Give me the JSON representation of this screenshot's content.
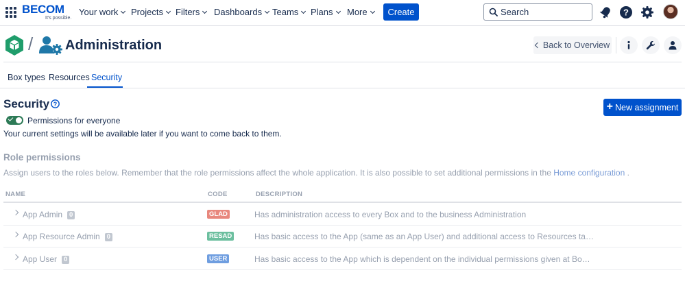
{
  "topnav": {
    "logo_brand": "BECOM",
    "logo_tagline": "It's possible.",
    "items": [
      "Your work",
      "Projects",
      "Filters",
      "Dashboards",
      "Teams",
      "Plans",
      "More"
    ],
    "create_label": "Create",
    "search_placeholder": "Search",
    "icons": [
      "app-switcher-icon",
      "notifications-icon",
      "help-icon",
      "settings-icon",
      "profile-avatar"
    ]
  },
  "header": {
    "title": "Administration",
    "back_label": "Back to Overview",
    "icons": [
      "info-icon",
      "wrench-icon",
      "user-icon"
    ]
  },
  "tabs": [
    {
      "label": "Box types",
      "active": false
    },
    {
      "label": "Resources",
      "active": false
    },
    {
      "label": "Security",
      "active": true
    }
  ],
  "security": {
    "title": "Security",
    "new_assignment_label": "New assignment",
    "toggle_label": "Permissions for everyone",
    "toggle_on": true,
    "info_text": "Your current settings will be available later if you want to come back to them."
  },
  "role_permissions": {
    "title": "Role permissions",
    "description": "Assign users to the roles below. Remember that the role permissions affect the whole application. It is also possible to set additional permissions in the",
    "link_text": "Home configuration",
    "trailing": "."
  },
  "table": {
    "columns": [
      "NAME",
      "CODE",
      "DESCRIPTION"
    ],
    "rows": [
      {
        "name": "App Admin",
        "count": "0",
        "code": "GLAD",
        "code_color": "#e8877d",
        "description": "Has administration access to every Box and to the business Administration"
      },
      {
        "name": "App Resource Admin",
        "count": "0",
        "code": "RESAD",
        "code_color": "#6cbf9f",
        "description": "Has basic access to the App (same as an App User) and additional access to Resources tab in Administration"
      },
      {
        "name": "App User",
        "count": "0",
        "code": "USER",
        "code_color": "#6f9ee0",
        "description": "Has basic access to the App which is dependent on the individual permissions given at Box levels"
      }
    ]
  },
  "colors": {
    "primary": "#0052cc",
    "toggle_on": "#2c7a56",
    "app_logo": "#1f9d6b",
    "admin_icon": "#1f78a8"
  }
}
